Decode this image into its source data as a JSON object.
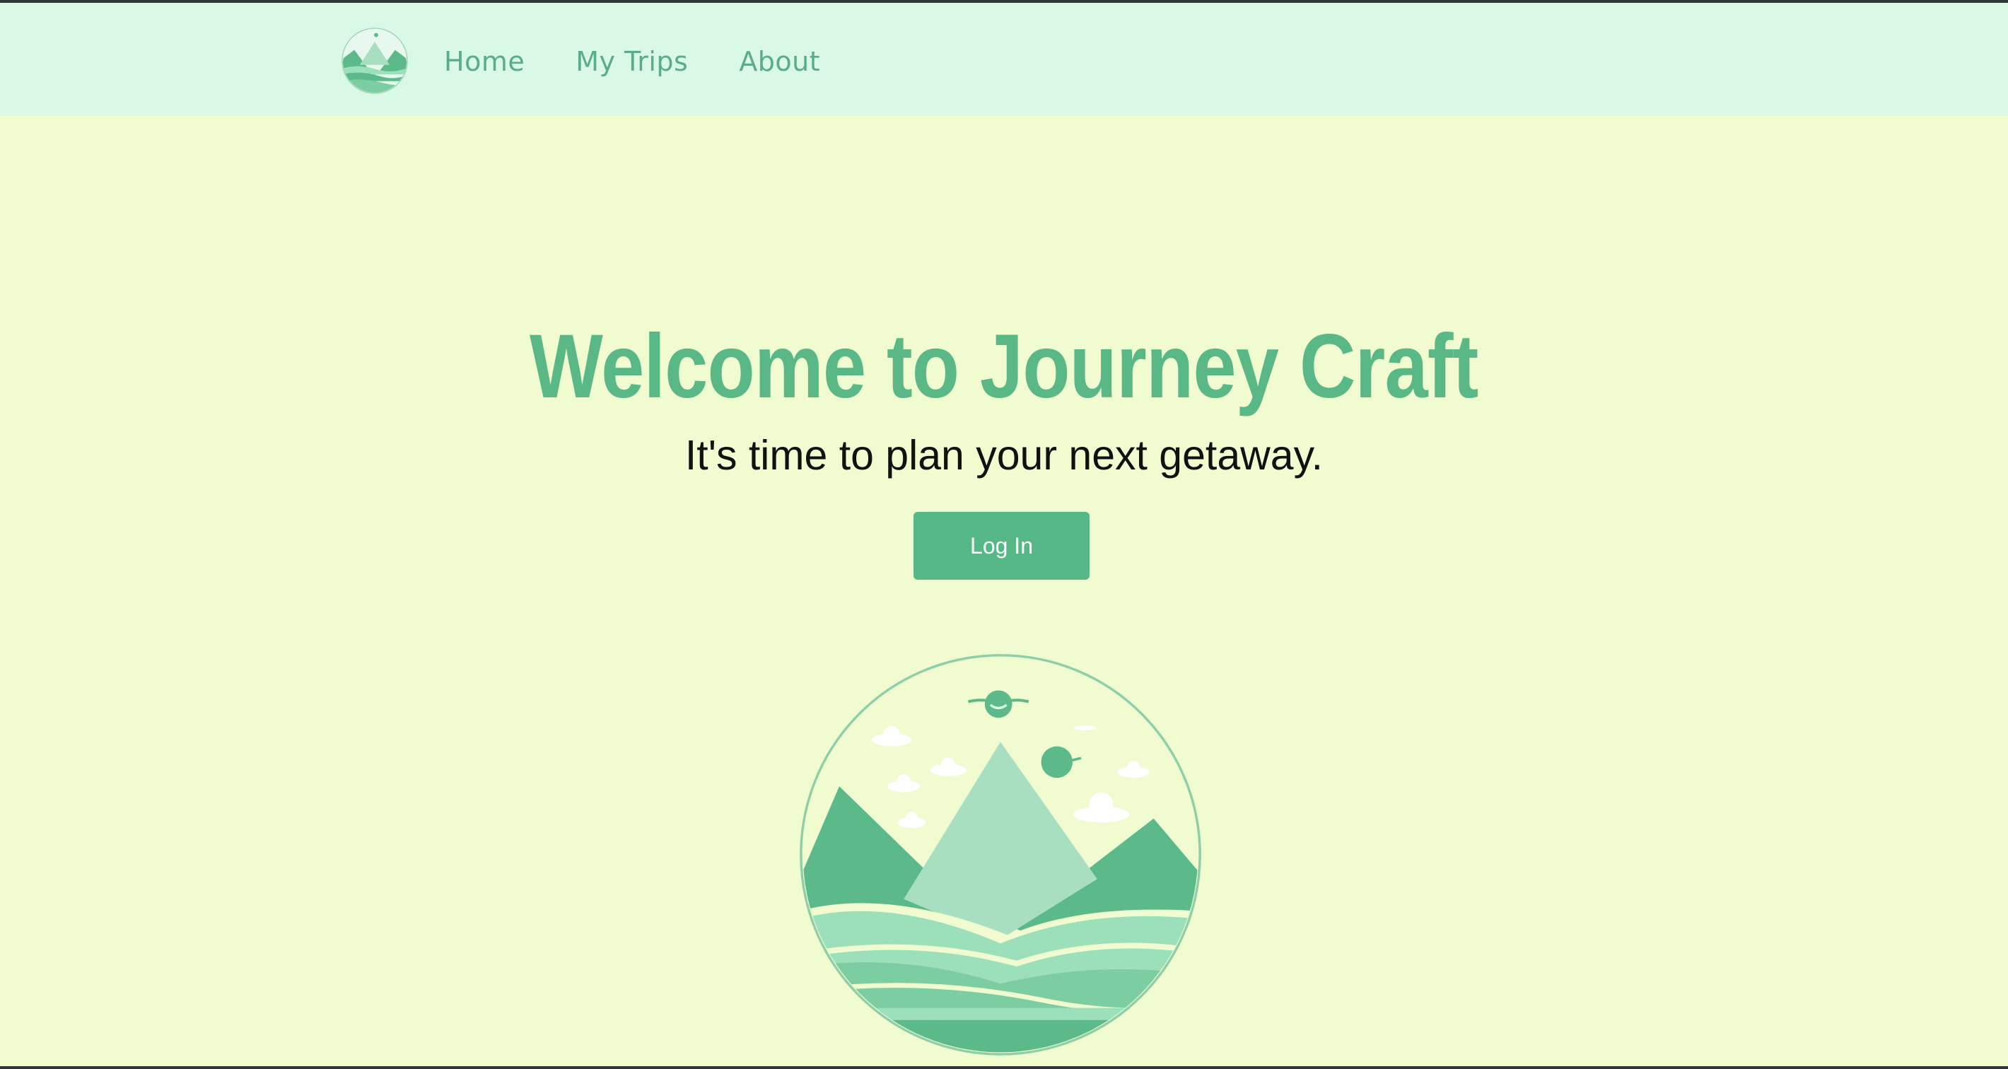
{
  "nav": {
    "logo_icon": "mountain-lake-logo-icon",
    "links": [
      "Home",
      "My Trips",
      "About"
    ]
  },
  "hero": {
    "title": "Welcome to Journey Craft",
    "subtitle": "It's time to plan your next getaway.",
    "login_label": "Log In",
    "illustration_icon": "mountain-lake-logo-icon"
  },
  "colors": {
    "accent": "#56b787",
    "nav_background": "#d9f8e6",
    "page_background": "#f0fbd0",
    "nav_text": "#5aae87"
  }
}
